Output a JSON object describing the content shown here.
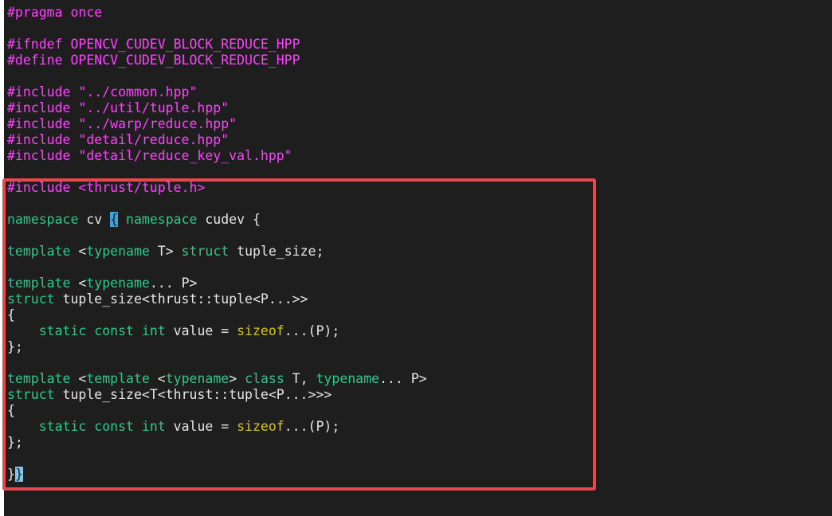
{
  "editor": {
    "lines": [
      {
        "segments": [
          {
            "t": "#pragma once",
            "c": "pp"
          }
        ]
      },
      {
        "segments": []
      },
      {
        "segments": [
          {
            "t": "#ifndef OPENCV_CUDEV_BLOCK_REDUCE_HPP",
            "c": "pp"
          }
        ]
      },
      {
        "segments": [
          {
            "t": "#define OPENCV_CUDEV_BLOCK_REDUCE_HPP",
            "c": "pp"
          }
        ]
      },
      {
        "segments": []
      },
      {
        "segments": [
          {
            "t": "#include ",
            "c": "pp"
          },
          {
            "t": "\"../common.hpp\"",
            "c": "str"
          }
        ]
      },
      {
        "segments": [
          {
            "t": "#include ",
            "c": "pp"
          },
          {
            "t": "\"../util/tuple.hpp\"",
            "c": "str"
          }
        ]
      },
      {
        "segments": [
          {
            "t": "#include ",
            "c": "pp"
          },
          {
            "t": "\"../warp/reduce.hpp\"",
            "c": "str"
          }
        ]
      },
      {
        "segments": [
          {
            "t": "#include ",
            "c": "pp"
          },
          {
            "t": "\"detail/reduce.hpp\"",
            "c": "str"
          }
        ]
      },
      {
        "segments": [
          {
            "t": "#include ",
            "c": "pp"
          },
          {
            "t": "\"detail/reduce_key_val.hpp\"",
            "c": "str"
          }
        ]
      },
      {
        "segments": []
      },
      {
        "segments": [
          {
            "t": "#include ",
            "c": "pp"
          },
          {
            "t": "<thrust/tuple.h>",
            "c": "str"
          }
        ]
      },
      {
        "segments": []
      },
      {
        "segments": [
          {
            "t": "namespace",
            "c": "kw"
          },
          {
            "t": " cv ",
            "c": "txt"
          },
          {
            "t": "{",
            "c": "brace-hl"
          },
          {
            "t": " ",
            "c": "txt"
          },
          {
            "t": "namespace",
            "c": "kw"
          },
          {
            "t": " cudev {",
            "c": "txt"
          }
        ]
      },
      {
        "segments": []
      },
      {
        "segments": [
          {
            "t": "template",
            "c": "kw"
          },
          {
            "t": " <",
            "c": "txt"
          },
          {
            "t": "typename",
            "c": "kw"
          },
          {
            "t": " T> ",
            "c": "txt"
          },
          {
            "t": "struct",
            "c": "kw"
          },
          {
            "t": " tuple_size;",
            "c": "txt"
          }
        ]
      },
      {
        "segments": []
      },
      {
        "segments": [
          {
            "t": "template",
            "c": "kw"
          },
          {
            "t": " <",
            "c": "txt"
          },
          {
            "t": "typename",
            "c": "kw"
          },
          {
            "t": "... P>",
            "c": "txt"
          }
        ]
      },
      {
        "segments": [
          {
            "t": "struct",
            "c": "kw"
          },
          {
            "t": " tuple_size<thrust::tuple<P...>>",
            "c": "txt"
          }
        ]
      },
      {
        "segments": [
          {
            "t": "{",
            "c": "txt"
          }
        ]
      },
      {
        "segments": [
          {
            "t": "    ",
            "c": "txt"
          },
          {
            "t": "static",
            "c": "kw"
          },
          {
            "t": " ",
            "c": "txt"
          },
          {
            "t": "const",
            "c": "kw"
          },
          {
            "t": " ",
            "c": "txt"
          },
          {
            "t": "int",
            "c": "kw"
          },
          {
            "t": " value = ",
            "c": "txt"
          },
          {
            "t": "sizeof",
            "c": "fn"
          },
          {
            "t": "...(P);",
            "c": "txt"
          }
        ]
      },
      {
        "segments": [
          {
            "t": "};",
            "c": "txt"
          }
        ]
      },
      {
        "segments": []
      },
      {
        "segments": [
          {
            "t": "template",
            "c": "kw"
          },
          {
            "t": " <",
            "c": "txt"
          },
          {
            "t": "template",
            "c": "kw"
          },
          {
            "t": " <",
            "c": "txt"
          },
          {
            "t": "typename",
            "c": "kw"
          },
          {
            "t": "> ",
            "c": "txt"
          },
          {
            "t": "class",
            "c": "kw"
          },
          {
            "t": " T, ",
            "c": "txt"
          },
          {
            "t": "typename",
            "c": "kw"
          },
          {
            "t": "... P>",
            "c": "txt"
          }
        ]
      },
      {
        "segments": [
          {
            "t": "struct",
            "c": "kw"
          },
          {
            "t": " tuple_size<T<thrust::tuple<P...>>>",
            "c": "txt"
          }
        ]
      },
      {
        "segments": [
          {
            "t": "{",
            "c": "txt"
          }
        ]
      },
      {
        "segments": [
          {
            "t": "    ",
            "c": "txt"
          },
          {
            "t": "static",
            "c": "kw"
          },
          {
            "t": " ",
            "c": "txt"
          },
          {
            "t": "const",
            "c": "kw"
          },
          {
            "t": " ",
            "c": "txt"
          },
          {
            "t": "int",
            "c": "kw"
          },
          {
            "t": " value = ",
            "c": "txt"
          },
          {
            "t": "sizeof",
            "c": "fn"
          },
          {
            "t": "...(P);",
            "c": "txt"
          }
        ]
      },
      {
        "segments": [
          {
            "t": "};",
            "c": "txt"
          }
        ]
      },
      {
        "segments": []
      },
      {
        "segments": [
          {
            "t": "}",
            "c": "txt"
          },
          {
            "t": "}",
            "c": "cursor-hl"
          }
        ]
      }
    ]
  },
  "colors": {
    "background": "#1e1e1e",
    "preprocessor": "#ff40ff",
    "keyword": "#2fc68f",
    "builtin": "#d7c414",
    "highlight_box": "#e8474e"
  }
}
